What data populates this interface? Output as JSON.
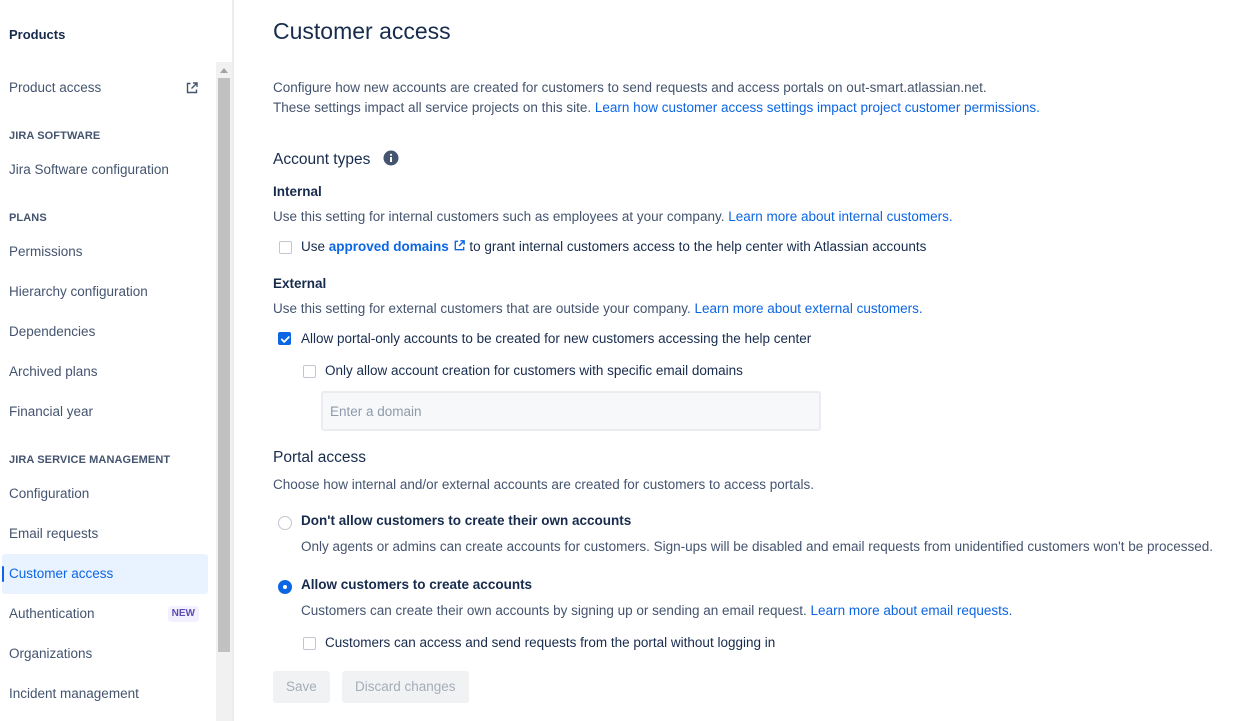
{
  "sidebar": {
    "products": "Products",
    "product_access": "Product access",
    "jira_software_heading": "JIRA SOFTWARE",
    "jira_software_config": "Jira Software configuration",
    "plans_heading": "PLANS",
    "permissions": "Permissions",
    "hierarchy_config": "Hierarchy configuration",
    "dependencies": "Dependencies",
    "archived_plans": "Archived plans",
    "financial_year": "Financial year",
    "jsm_heading": "JIRA SERVICE MANAGEMENT",
    "configuration": "Configuration",
    "email_requests": "Email requests",
    "customer_access": "Customer access",
    "authentication": "Authentication",
    "new_badge": "NEW",
    "organizations": "Organizations",
    "incident_management": "Incident management"
  },
  "main": {
    "title": "Customer access",
    "intro_line1": "Configure how new accounts are created for customers to send requests and access portals on out-smart.atlassian.net.",
    "intro_line2": "These settings impact all service projects on this site.",
    "intro_link": "Learn how customer access settings impact project customer permissions.",
    "account_types": "Account types",
    "internal_heading": "Internal",
    "internal_desc": "Use this setting for internal customers such as employees at your company.",
    "internal_link": "Learn more about internal customers.",
    "internal_checkbox_pre": "Use",
    "internal_checkbox_link": "approved domains",
    "internal_checkbox_post": "to grant internal customers access to the help center with Atlassian accounts",
    "external_heading": "External",
    "external_desc": "Use this setting for external customers that are outside your company.",
    "external_link": "Learn more about external customers.",
    "external_checkbox": "Allow portal-only accounts to be created for new customers accessing the help center",
    "domain_checkbox": "Only allow account creation for customers with specific email domains",
    "domain_placeholder": "Enter a domain",
    "portal_access": "Portal access",
    "portal_desc": "Choose how internal and/or external accounts are created for customers to access portals.",
    "radio1_label": "Don't allow customers to create their own accounts",
    "radio1_desc": "Only agents or admins can create accounts for customers. Sign-ups will be disabled and email requests from unidentified customers won't be processed.",
    "radio2_label": "Allow customers to create accounts",
    "radio2_desc": "Customers can create their own accounts by signing up or sending an email request.",
    "radio2_link": "Learn more about email requests.",
    "anon_checkbox": "Customers can access and send requests from the portal without logging in",
    "save": "Save",
    "discard": "Discard changes"
  },
  "colors": {
    "accent": "#0c66e4",
    "text": "#172b4d",
    "subtle_text": "#44546f"
  }
}
